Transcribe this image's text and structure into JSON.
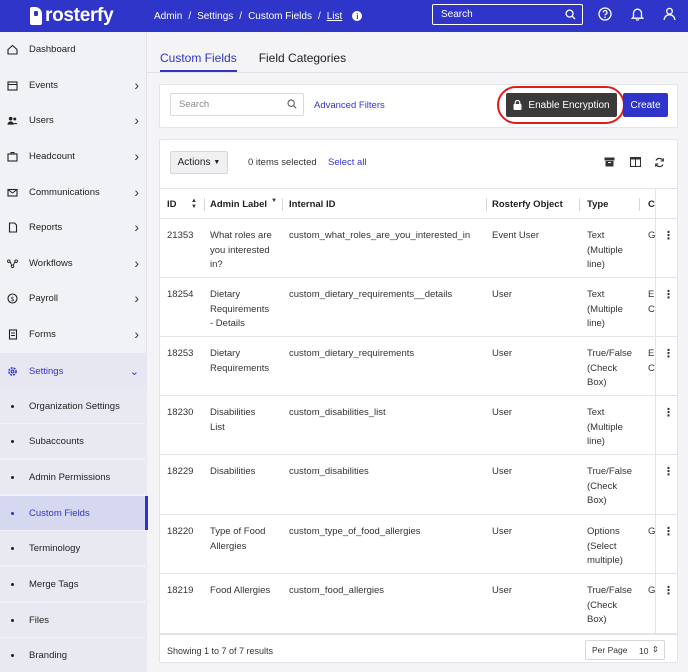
{
  "app": {
    "logo_text": "rosterfy"
  },
  "breadcrumb": [
    "Admin",
    "Settings",
    "Custom Fields",
    "List"
  ],
  "top_search": {
    "placeholder": "Search"
  },
  "sidebar": {
    "items": [
      {
        "label": "Dashboard",
        "icon": "home-icon"
      },
      {
        "label": "Events",
        "icon": "calendar-icon"
      },
      {
        "label": "Users",
        "icon": "users-icon"
      },
      {
        "label": "Headcount",
        "icon": "briefcase-icon"
      },
      {
        "label": "Communications",
        "icon": "mail-icon"
      },
      {
        "label": "Reports",
        "icon": "file-icon"
      },
      {
        "label": "Workflows",
        "icon": "workflow-icon"
      },
      {
        "label": "Payroll",
        "icon": "dollar-icon"
      },
      {
        "label": "Forms",
        "icon": "form-icon"
      },
      {
        "label": "Settings",
        "icon": "gear-icon"
      }
    ],
    "settings_subitems": [
      "Organization Settings",
      "Subaccounts",
      "Admin Permissions",
      "Custom Fields",
      "Terminology",
      "Merge Tags",
      "Files",
      "Branding"
    ]
  },
  "tabs": [
    "Custom Fields",
    "Field Categories"
  ],
  "filters": {
    "search_placeholder": "Search",
    "advanced_filters": "Advanced Filters",
    "enable_encryption": "Enable Encryption",
    "create": "Create"
  },
  "toolbar": {
    "actions": "Actions",
    "items_selected": "0 items selected",
    "select_all": "Select all"
  },
  "table": {
    "columns": [
      "ID",
      "Admin Label",
      "Internal ID",
      "Rosterfy Object",
      "Type",
      "C"
    ],
    "rows": [
      {
        "id": "21353",
        "label": [
          "What roles are",
          "you interested",
          "in?"
        ],
        "internal": "custom_what_roles_are_you_interested_in",
        "object": "Event User",
        "type": [
          "Text",
          "(Multiple",
          "line)"
        ],
        "c": [
          "G"
        ]
      },
      {
        "id": "18254",
        "label": [
          "Dietary",
          "Requirements",
          "- Details"
        ],
        "internal": "custom_dietary_requirements__details",
        "object": "User",
        "type": [
          "Text",
          "(Multiple",
          "line)"
        ],
        "c": [
          "E",
          "C"
        ]
      },
      {
        "id": "18253",
        "label": [
          "Dietary",
          "Requirements"
        ],
        "internal": "custom_dietary_requirements",
        "object": "User",
        "type": [
          "True/False",
          "(Check",
          "Box)"
        ],
        "c": [
          "E",
          "C"
        ]
      },
      {
        "id": "18230",
        "label": [
          "Disabilities",
          "List"
        ],
        "internal": "custom_disabilities_list",
        "object": "User",
        "type": [
          "Text",
          "(Multiple",
          "line)"
        ],
        "c": []
      },
      {
        "id": "18229",
        "label": [
          "Disabilities"
        ],
        "internal": "custom_disabilities",
        "object": "User",
        "type": [
          "True/False",
          "(Check",
          "Box)"
        ],
        "c": []
      },
      {
        "id": "18220",
        "label": [
          "Type of Food",
          "Allergies"
        ],
        "internal": "custom_type_of_food_allergies",
        "object": "User",
        "type": [
          "Options",
          "(Select",
          "multiple)"
        ],
        "c": [
          "G"
        ]
      },
      {
        "id": "18219",
        "label": [
          "Food Allergies"
        ],
        "internal": "custom_food_allergies",
        "object": "User",
        "type": [
          "True/False",
          "(Check",
          "Box)"
        ],
        "c": [
          "G"
        ]
      }
    ]
  },
  "footer": {
    "showing": "Showing 1 to 7 of 7 results",
    "per_page_label": "Per Page",
    "per_page_value": "10"
  }
}
